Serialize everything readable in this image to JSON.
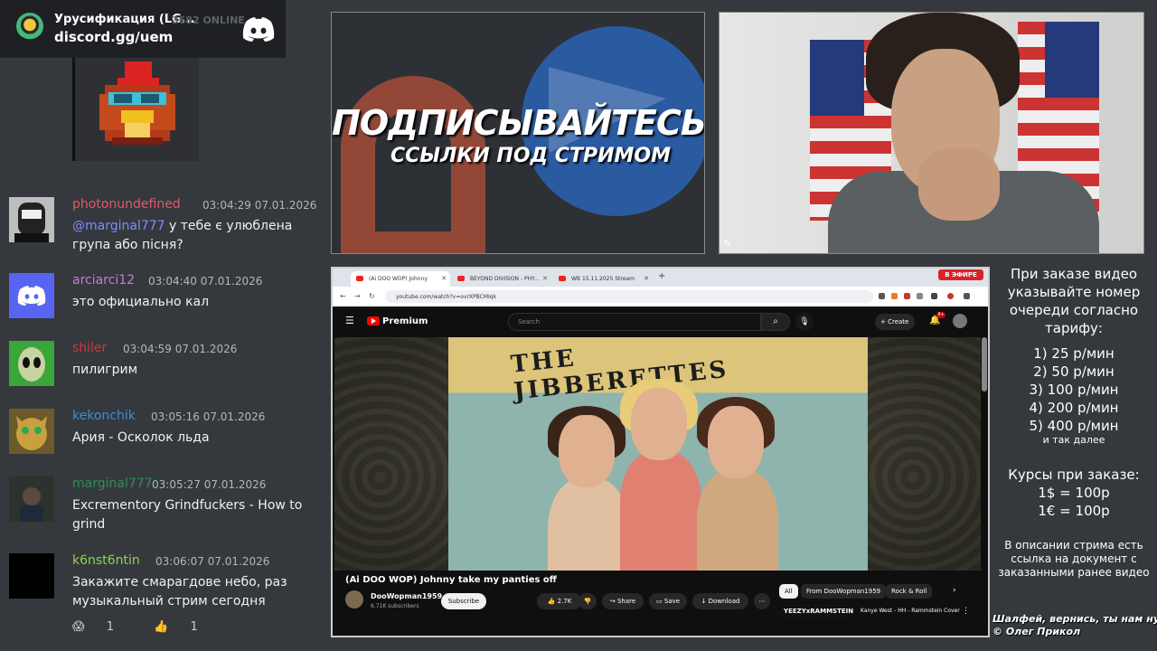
{
  "discord": {
    "server_name": "Урусификация (LG...",
    "online": "3682 ONLINE",
    "invite": "discord.gg/uem"
  },
  "chat": [
    {
      "user": "photonundefined",
      "time": "03:04:29 07.01.2026",
      "mention": "@marginal777",
      "text": "у тебе є улюблена група або пісня?",
      "user_color": "#e05b6b",
      "avatar_color": "#c9c9c9"
    },
    {
      "user": "arciarci12",
      "time": "03:04:40 07.01.2026",
      "mention": "",
      "text": "это официально кал",
      "user_color": "#c77bd8",
      "avatar_color": "#5865f2"
    },
    {
      "user": "shiler",
      "time": "03:04:59 07.01.2026",
      "mention": "",
      "text": "пилигрим",
      "user_color": "#d8333c",
      "avatar_color": "#3aa63a"
    },
    {
      "user": "kekonchik",
      "time": "03:05:16 07.01.2026",
      "mention": "",
      "text": "Ария - Осколок льда",
      "user_color": "#3b8fd6",
      "avatar_color": "#9a7a30"
    },
    {
      "user": "marginal777",
      "time": "03:05:27 07.01.2026",
      "mention": "",
      "text": "Excrementory Grindfuckers - How to grind",
      "user_color": "#2f8f5a",
      "avatar_color": "#3a4a3a"
    },
    {
      "user": "k6nst6ntin",
      "time": "03:06:07 07.01.2026",
      "mention": "",
      "text": "Закажите смарагдове небо, раз музыкальный стрим сегодня",
      "user_color": "#8dd64a",
      "avatar_color": "#000000"
    }
  ],
  "reactions": [
    {
      "icon": "😱",
      "count": "1"
    },
    {
      "icon": "👍",
      "count": "1"
    }
  ],
  "promo": {
    "title": "ПОДПИСЫВАЙТЕСЬ",
    "subtitle": "ССЫЛКИ ПОД СТРИМОМ"
  },
  "browser": {
    "tabs": [
      {
        "label": "(Ai DOO WOP) Johnny"
      },
      {
        "label": "BEYOND DIVISION - PHY..."
      },
      {
        "label": "WB 15.11.2025 Stream"
      }
    ],
    "new_tab": "+",
    "live_badge": "В ЭФИРЕ",
    "url": "youtube.com/watch?v=ovrXPBCMIqk"
  },
  "youtube": {
    "brand": "Premium",
    "search_placeholder": "Search",
    "create_label": "Create",
    "notif_count": "9+",
    "album_title": "THE JIBBERETTES",
    "video_title": "(Ai DOO WOP) Johnny take my panties off",
    "channel": "DooWopman1959",
    "subscribers": "6.71K subscribers",
    "subscribe": "Subscribe",
    "likes": "2.7K",
    "share": "Share",
    "save": "Save",
    "download": "Download",
    "chips": [
      "All",
      "From DooWopman1959",
      "Rock & Roll"
    ],
    "rec_thumb_text": "YEEZYxRAMMSTEIN",
    "rec_title": "Kanye West - HH - Rammstein Cover"
  },
  "info": {
    "head": "При заказе видео указывайте номер очереди согласно тарифу:",
    "prices": [
      "1) 25 р/мин",
      "2) 50 р/мин",
      "3) 100 р/мин",
      "4) 200 р/мин",
      "5) 400 р/мин"
    ],
    "prices_more": "и так далее",
    "courses_title": "Курсы при заказе:",
    "courses": [
      "1$ = 100р",
      "1€ = 100р"
    ],
    "desc": "В описании стрима есть ссылка на документ с заказанными ранее видео",
    "credit_line1": "Шалфей, вернись, ты нам нужен.",
    "credit_line2": "© Олег Прикол"
  }
}
